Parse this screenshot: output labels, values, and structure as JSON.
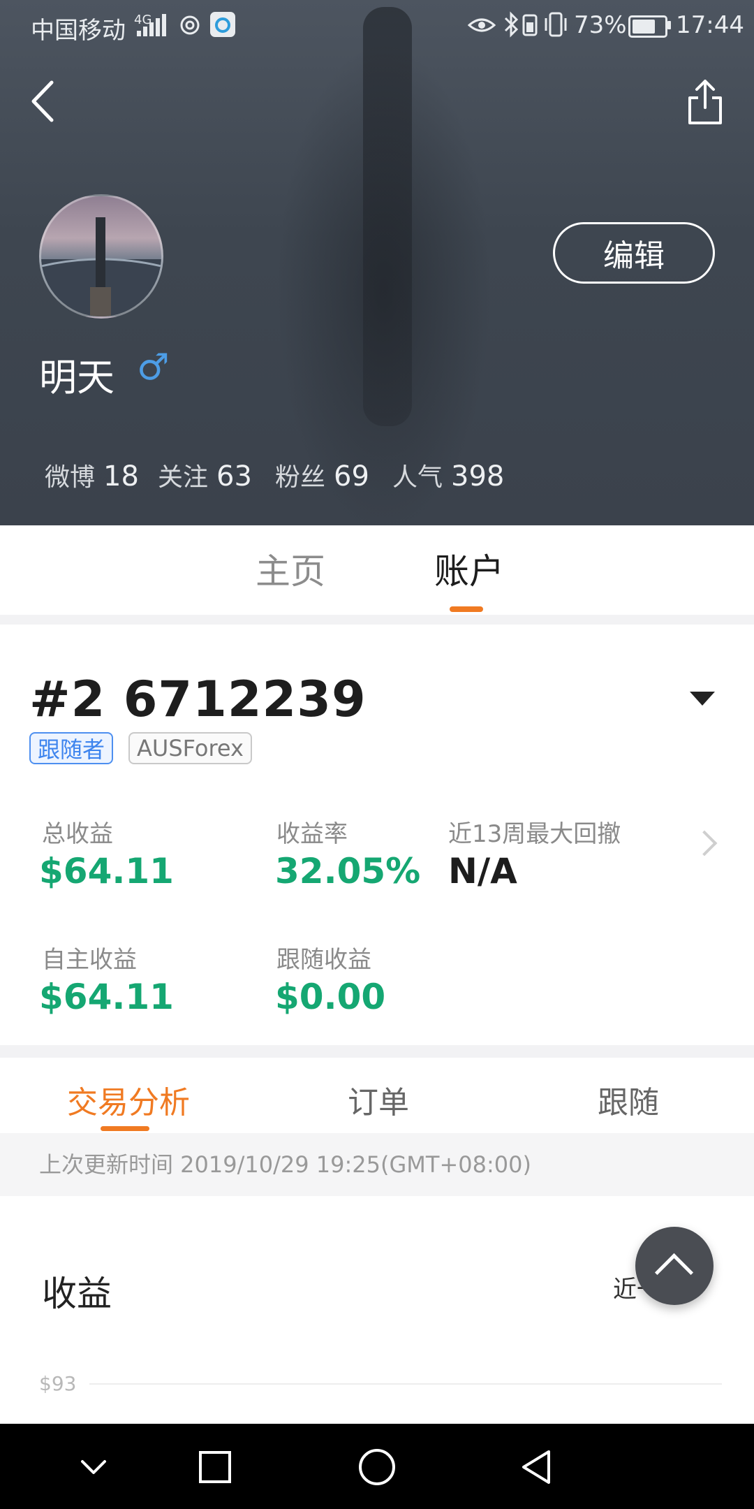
{
  "status_bar": {
    "carrier": "中国移动",
    "network": "4G",
    "battery": "73%",
    "battery_level": 0.73,
    "time": "17:44"
  },
  "profile": {
    "username": "明天",
    "gender_symbol": "♂",
    "edit_label": "编辑",
    "stats": [
      {
        "label": "微博",
        "value": "18"
      },
      {
        "label": "关注",
        "value": "63"
      },
      {
        "label": "粉丝",
        "value": "69"
      },
      {
        "label": "人气",
        "value": "398"
      }
    ]
  },
  "main_tabs": [
    {
      "label": "主页",
      "active": false
    },
    {
      "label": "账户",
      "active": true
    }
  ],
  "account": {
    "number": "#2 6712239",
    "tags": [
      "跟随者",
      "AUSForex"
    ],
    "metrics": [
      {
        "label": "总收益",
        "value": "$64.11",
        "color": "#15a772"
      },
      {
        "label": "收益率",
        "value": "32.05%",
        "color": "#15a772"
      },
      {
        "label": "近13周最大回撤",
        "value": "N/A",
        "color": "#1d1d1d"
      },
      {
        "label": "自主收益",
        "value": "$64.11",
        "color": "#15a772"
      },
      {
        "label": "跟随收益",
        "value": "$0.00",
        "color": "#15a772"
      }
    ]
  },
  "sub_tabs": [
    {
      "label": "交易分析",
      "active": true
    },
    {
      "label": "订单",
      "active": false
    },
    {
      "label": "跟随",
      "active": false
    }
  ],
  "last_updated": "上次更新时间 2019/10/29 19:25(GMT+08:00)",
  "earnings": {
    "title": "收益",
    "period": "近一年",
    "y_top_label": "$93"
  },
  "colors": {
    "accent": "#f07a22",
    "profit_green": "#15a772",
    "tag_blue": "#3d84ee"
  },
  "icons": [
    "back-icon",
    "share-icon",
    "gender-male-icon",
    "dropdown-triangle-icon",
    "chevron-right-icon",
    "scroll-top-icon",
    "nav-back-icon",
    "nav-home-icon",
    "nav-recents-icon",
    "nav-hide-icon"
  ]
}
